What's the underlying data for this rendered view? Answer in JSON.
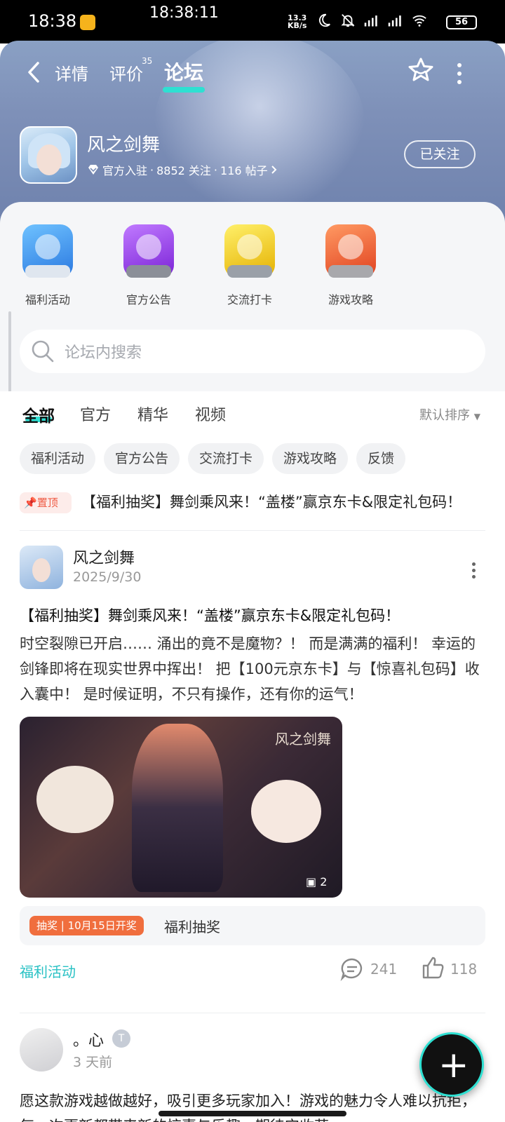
{
  "status_bar": {
    "time": "18:38",
    "center_time": "18:38:11",
    "net_speed_value": "13.3",
    "net_speed_unit": "KB/s",
    "battery": "56"
  },
  "header": {
    "tabs": [
      {
        "label": "详情"
      },
      {
        "label": "评价",
        "count": "35"
      },
      {
        "label": "论坛"
      }
    ],
    "game": {
      "name": "风之剑舞",
      "official": "官方入驻",
      "follows": "8852 关注",
      "posts": "116 帖子",
      "follow_button": "已关注"
    }
  },
  "categories": [
    {
      "label": "福利活动",
      "color": "#2a78e0"
    },
    {
      "label": "官方公告",
      "color": "#7a22d6"
    },
    {
      "label": "交流打卡",
      "color": "#e4b000"
    },
    {
      "label": "游戏攻略",
      "color": "#e0401f"
    }
  ],
  "search": {
    "placeholder": "论坛内搜索"
  },
  "filter_tabs": [
    "全部",
    "官方",
    "精华",
    "视频"
  ],
  "sort_label": "默认排序",
  "chips": [
    "福利活动",
    "官方公告",
    "交流打卡",
    "游戏攻略",
    "反馈"
  ],
  "pinned": {
    "badge": "置顶",
    "title": "【福利抽奖】舞剑乘风来！“盖楼”赢京东卡&限定礼包码！"
  },
  "post": {
    "author": "风之剑舞",
    "date": "2025/9/30",
    "title": "【福利抽奖】舞剑乘风来！“盖楼”赢京东卡&限定礼包码！",
    "body": "时空裂隙已开启…… 涌出的竟不是魔物？！ 而是满满的福利！ 幸运的剑锋即将在现实世界中挥出！ 把【100元京东卡】与【惊喜礼包码】收入囊中！ 是时候证明，不只有操作，还有你的运气！",
    "image_logo": "风之剑舞",
    "image_count": "2",
    "lottery_badge": "抽奖 | 10月15日开奖",
    "lottery_text": "福利抽奖",
    "tag": "福利活动",
    "comments": "241",
    "likes": "118"
  },
  "post2": {
    "author": "。心",
    "badge": "T",
    "date": "3 天前",
    "body": "愿这款游戏越做越好，吸引更多玩家加入！游戏的魅力令人难以抗拒，每一次更新都带来新的惊喜与乐趣，期待它收获"
  },
  "fab": {
    "label": "+"
  },
  "colors": {
    "accent": "#2ee0d2",
    "tag": "#28c1c4",
    "lottery": "#f06e3e",
    "pin": "#ef5a43"
  }
}
